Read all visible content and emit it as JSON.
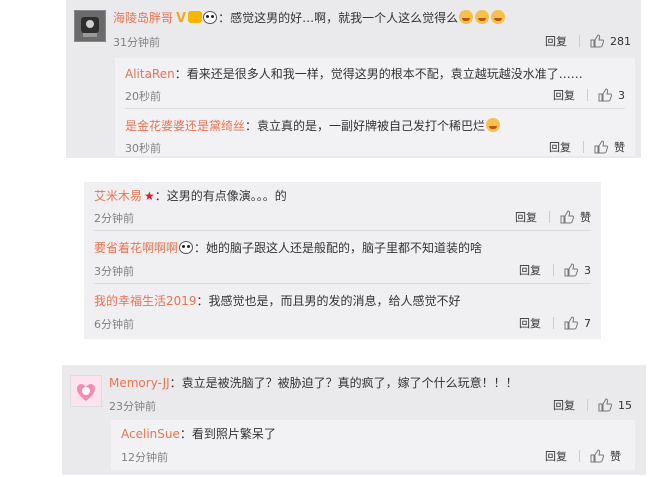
{
  "block1": {
    "main": {
      "user": "海陵岛胖哥",
      "text": "：感觉这男的好…啊，就我一个人这么觉得么",
      "time": "31分钟前",
      "reply_label": "回复",
      "likes": "281"
    },
    "replies": [
      {
        "user": "AlitaRen",
        "text": "：看来还是很多人和我一样，觉得这男的根本不配，袁立越玩越没水准了……",
        "time": "20秒前",
        "reply_label": "回复",
        "likes": "3"
      },
      {
        "user": "是金花婆婆还是黛绮丝",
        "text": "：袁立真的是，一副好牌被自己发打个稀巴烂",
        "time": "30秒前",
        "reply_label": "回复",
        "likes": "赞"
      }
    ]
  },
  "block2": {
    "items": [
      {
        "user": "艾米木易",
        "text": "：这男的有点像演。。。的",
        "time": "2分钟前",
        "reply_label": "回复",
        "likes": "赞"
      },
      {
        "user": "要省着花啊啊啊",
        "text": "：她的脑子跟这人还是般配的，脑子里都不知道装的啥",
        "time": "3分钟前",
        "reply_label": "回复",
        "likes": "3"
      },
      {
        "user": "我的幸福生活2019",
        "text": "：我感觉也是，而且男的发的消息，给人感觉不好",
        "time": "6分钟前",
        "reply_label": "回复",
        "likes": "7"
      }
    ]
  },
  "block3": {
    "main": {
      "user": "Memory-JJ",
      "text": "：袁立是被洗脑了？被胁迫了？真的疯了，嫁了个什么玩意！！！",
      "time": "23分钟前",
      "reply_label": "回复",
      "likes": "15"
    },
    "reply": {
      "user": "AcelinSue",
      "text": "：看到照片繁呆了",
      "time": "12分钟前",
      "reply_label": "回复",
      "likes": "赞"
    }
  },
  "colors": {
    "username": "#eb7350",
    "panel": "#eaeaec",
    "reply_box": "#f2f2f5",
    "meta": "#808080"
  }
}
